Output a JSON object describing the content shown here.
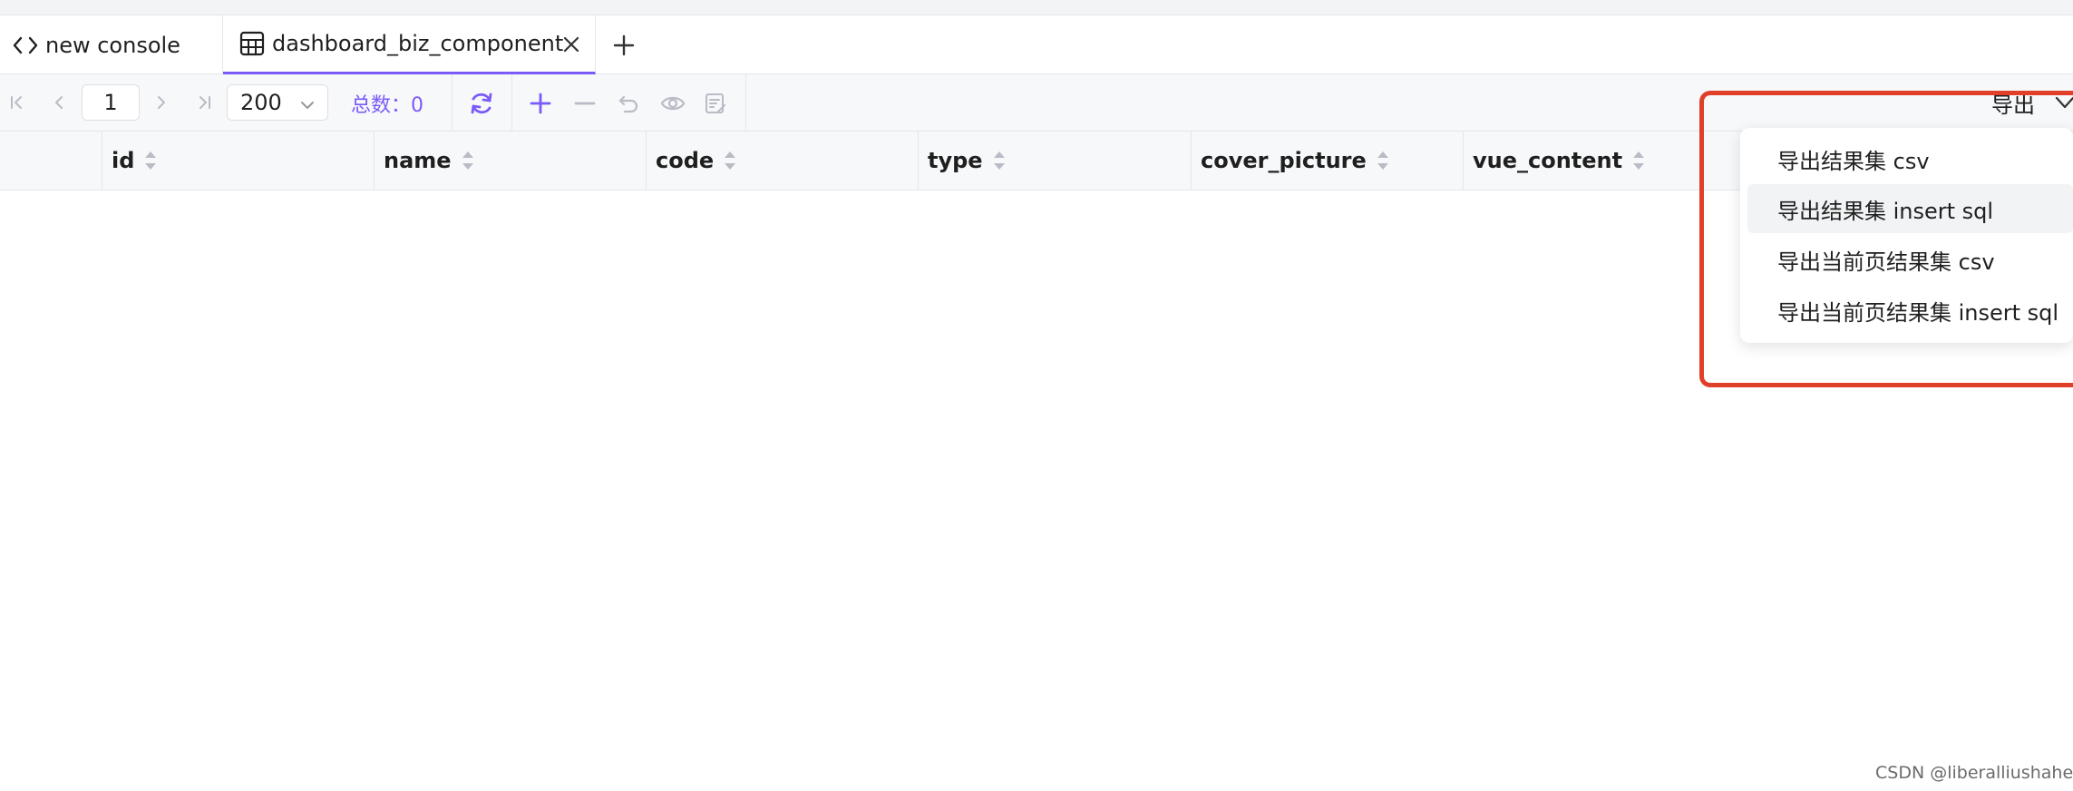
{
  "tabs": [
    {
      "label": "new console",
      "icon": "code-icon",
      "active": false
    },
    {
      "label": "dashboard_biz_component",
      "icon": "table-icon",
      "active": true
    }
  ],
  "toolbar": {
    "page_value": "1",
    "page_size_value": "200",
    "total_label": "总数：0",
    "export_label": "导出"
  },
  "columns": [
    {
      "label": "id"
    },
    {
      "label": "name"
    },
    {
      "label": "code"
    },
    {
      "label": "type"
    },
    {
      "label": "cover_picture"
    },
    {
      "label": "vue_content"
    }
  ],
  "export_menu": {
    "items": [
      {
        "label": "导出结果集 csv"
      },
      {
        "label": "导出结果集 insert sql"
      },
      {
        "label": "导出当前页结果集 csv"
      },
      {
        "label": "导出当前页结果集 insert sql"
      }
    ],
    "hovered_index": 1
  },
  "watermark": "CSDN @liberalliushahe",
  "colors": {
    "accent": "#7a5af8",
    "highlight_border": "#e0402a",
    "disabled_icon": "#b8bcc4"
  }
}
